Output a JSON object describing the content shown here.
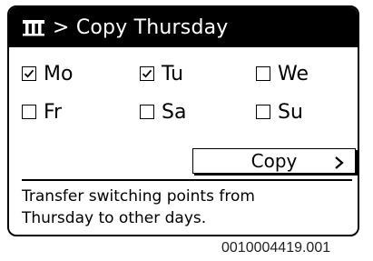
{
  "header": {
    "icon": "program-table-icon",
    "title": "> Copy Thursday"
  },
  "days": [
    {
      "label": "Mo",
      "checked": true
    },
    {
      "label": "Tu",
      "checked": true
    },
    {
      "label": "We",
      "checked": false
    },
    {
      "label": "Fr",
      "checked": false
    },
    {
      "label": "Sa",
      "checked": false
    },
    {
      "label": "Su",
      "checked": false
    }
  ],
  "copy_button": {
    "label": "Copy",
    "icon": "chevron-right-icon"
  },
  "info": {
    "line1": "Transfer switching points from",
    "line2": "Thursday to other days."
  },
  "figure_code": "0010004419.001"
}
